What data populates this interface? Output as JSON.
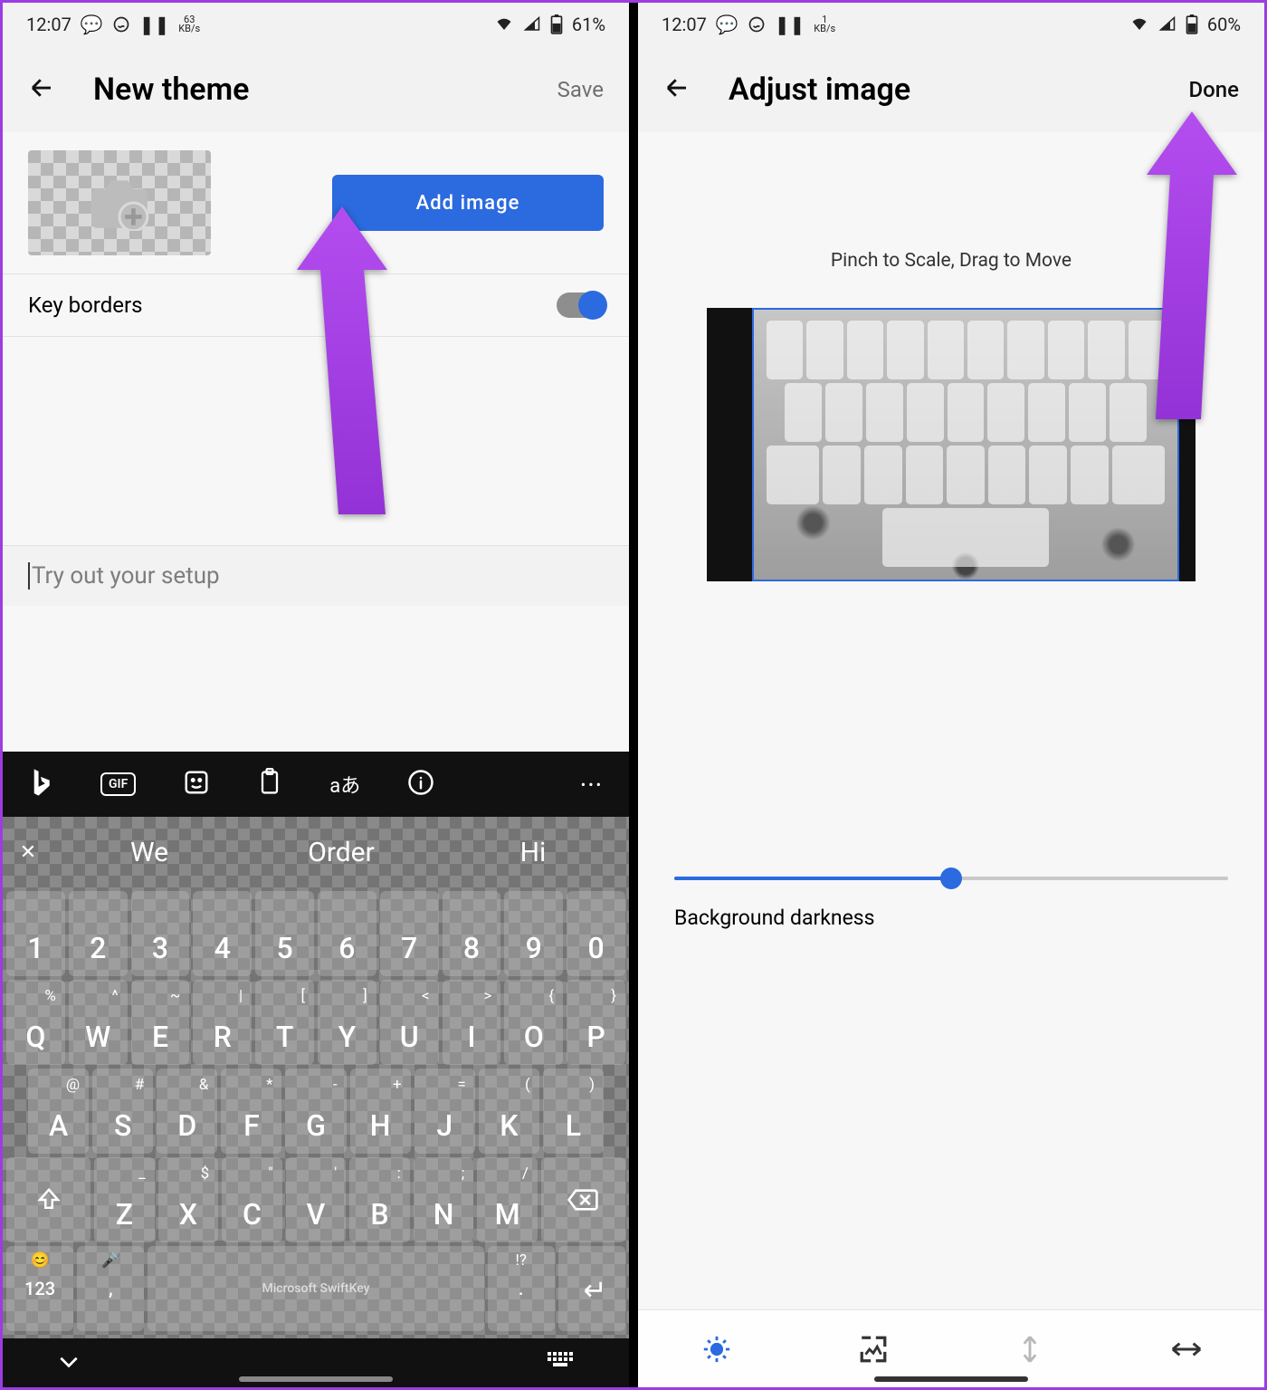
{
  "left": {
    "statusbar": {
      "time": "12:07",
      "kb_rate": "63",
      "kb_unit": "KB/s",
      "battery": "61%"
    },
    "appbar": {
      "title": "New theme",
      "action": "Save"
    },
    "add_image": "Add image",
    "key_borders": "Key borders",
    "try_placeholder": "Try out your setup",
    "suggestions": {
      "s1": "We",
      "s2": "Order",
      "s3": "Hi"
    },
    "numbers": [
      "1",
      "2",
      "3",
      "4",
      "5",
      "6",
      "7",
      "8",
      "9",
      "0"
    ],
    "row2": [
      {
        "l": "Q",
        "s": "%"
      },
      {
        "l": "W",
        "s": "^"
      },
      {
        "l": "E",
        "s": "~"
      },
      {
        "l": "R",
        "s": "|"
      },
      {
        "l": "T",
        "s": "["
      },
      {
        "l": "Y",
        "s": "]"
      },
      {
        "l": "U",
        "s": "<"
      },
      {
        "l": "I",
        "s": ">"
      },
      {
        "l": "O",
        "s": "{"
      },
      {
        "l": "P",
        "s": "}"
      }
    ],
    "row3": [
      {
        "l": "A",
        "s": "@"
      },
      {
        "l": "S",
        "s": "#"
      },
      {
        "l": "D",
        "s": "&"
      },
      {
        "l": "F",
        "s": "*"
      },
      {
        "l": "G",
        "s": "-"
      },
      {
        "l": "H",
        "s": "+"
      },
      {
        "l": "J",
        "s": "="
      },
      {
        "l": "K",
        "s": "("
      },
      {
        "l": "L",
        "s": ")"
      }
    ],
    "row4": [
      {
        "l": "Z",
        "s": "_"
      },
      {
        "l": "X",
        "s": "$"
      },
      {
        "l": "C",
        "s": "\""
      },
      {
        "l": "V",
        "s": "'"
      },
      {
        "l": "B",
        "s": ":"
      },
      {
        "l": "N",
        "s": ";"
      },
      {
        "l": "M",
        "s": "/"
      }
    ],
    "bottom": {
      "num_key": "123",
      "space": "Microsoft SwiftKey",
      "comma": ",",
      "period": ".",
      "qex": "!?"
    },
    "toolbar_translate": "aあ"
  },
  "right": {
    "statusbar": {
      "time": "12:07",
      "kb_rate": "1",
      "kb_unit": "KB/s",
      "battery": "60%"
    },
    "appbar": {
      "title": "Adjust image",
      "action": "Done"
    },
    "instruction": "Pinch to Scale, Drag to Move",
    "slider_label": "Background darkness",
    "slider_value": 0.5
  }
}
